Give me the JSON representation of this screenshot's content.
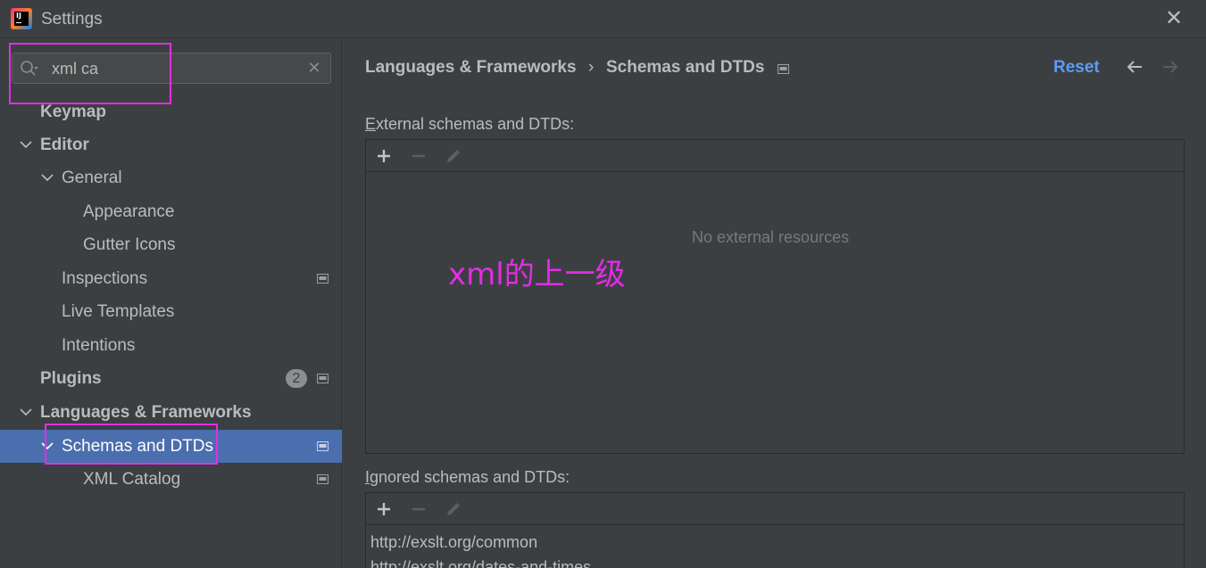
{
  "window": {
    "title": "Settings"
  },
  "search": {
    "value": "xml ca"
  },
  "sidebar": {
    "items": [
      {
        "label": "Keymap"
      },
      {
        "label": "Editor"
      },
      {
        "label": "General"
      },
      {
        "label": "Appearance"
      },
      {
        "label": "Gutter Icons"
      },
      {
        "label": "Inspections"
      },
      {
        "label": "Live Templates"
      },
      {
        "label": "Intentions"
      },
      {
        "label": "Plugins",
        "badge": "2"
      },
      {
        "label": "Languages & Frameworks"
      },
      {
        "label": "Schemas and DTDs"
      },
      {
        "label": "XML Catalog"
      }
    ]
  },
  "breadcrumb": {
    "parent": "Languages & Frameworks",
    "separator": "›",
    "current": "Schemas and DTDs"
  },
  "header": {
    "reset": "Reset"
  },
  "external": {
    "label_mnemonic": "E",
    "label_rest": "xternal schemas and DTDs:",
    "empty": "No external resources"
  },
  "ignored": {
    "label_mnemonic": "I",
    "label_rest": "gnored schemas and DTDs:",
    "rows": [
      "http://exslt.org/common",
      "http://exslt.org/dates-and-times"
    ]
  },
  "annotation": {
    "text": "xml的上一级"
  },
  "colors": {
    "accent": "#589df6",
    "selection": "#4b6eaf",
    "annotation": "#e22de6",
    "background": "#3c3f41"
  }
}
